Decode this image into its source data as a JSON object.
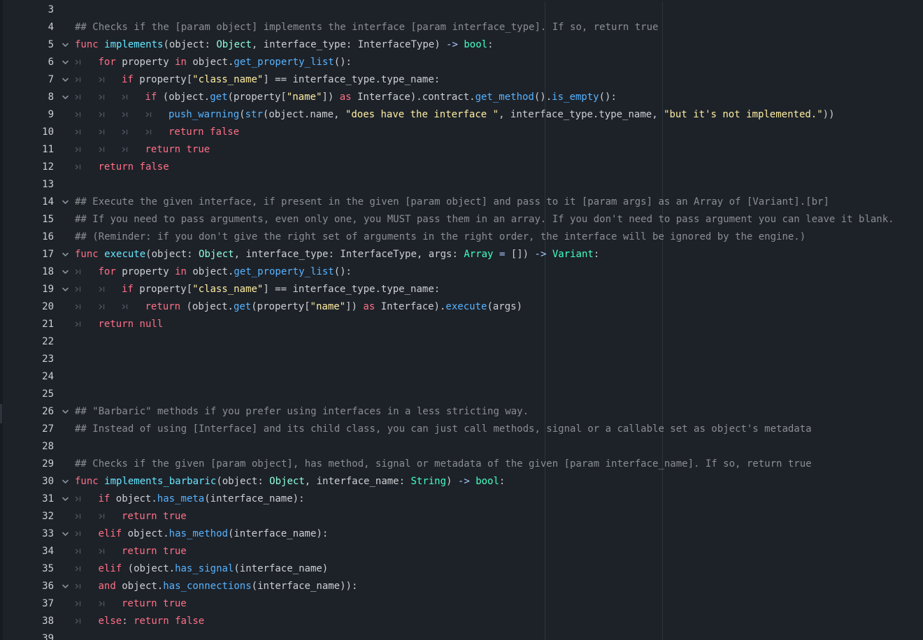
{
  "editor": {
    "language": "GDScript",
    "colors": {
      "background": "#1d2229",
      "keyword": "#ff7085",
      "function_call": "#57b3ff",
      "function_def": "#66e6ff",
      "type": "#8effda",
      "builtin_type": "#42ffc2",
      "string": "#ffeda1",
      "comment": "#cdcfd2a0",
      "text": "#cdcfd2"
    },
    "indent_glyph": "›|",
    "fold_icon": "chevron-down-icon",
    "lines": [
      {
        "n": "3",
        "fold": false,
        "indent": 0,
        "tokens": []
      },
      {
        "n": "4",
        "fold": false,
        "indent": 0,
        "tokens": [
          [
            "c",
            "## Checks if the [param object] implements the interface [param interface_type]. If so, return true"
          ]
        ]
      },
      {
        "n": "5",
        "fold": true,
        "indent": 0,
        "tokens": [
          [
            "k",
            "func"
          ],
          [
            "p",
            " "
          ],
          [
            "fd",
            "implements"
          ],
          [
            "p",
            "(object: "
          ],
          [
            "t",
            "Object"
          ],
          [
            "p",
            ", interface_type: "
          ],
          [
            "p",
            "InterfaceType"
          ],
          [
            "p",
            ") "
          ],
          [
            "o",
            "->"
          ],
          [
            "p",
            " "
          ],
          [
            "ty",
            "bool"
          ],
          [
            "p",
            ":"
          ]
        ]
      },
      {
        "n": "6",
        "fold": true,
        "indent": 1,
        "tokens": [
          [
            "k",
            "for"
          ],
          [
            "p",
            " property "
          ],
          [
            "k",
            "in"
          ],
          [
            "p",
            " object."
          ],
          [
            "f",
            "get_property_list"
          ],
          [
            "p",
            "():"
          ]
        ]
      },
      {
        "n": "7",
        "fold": true,
        "indent": 2,
        "tokens": [
          [
            "k",
            "if"
          ],
          [
            "p",
            " property["
          ],
          [
            "s",
            "\"class_name\""
          ],
          [
            "p",
            "] == interface_type.type_name:"
          ]
        ]
      },
      {
        "n": "8",
        "fold": true,
        "indent": 3,
        "tokens": [
          [
            "k",
            "if"
          ],
          [
            "p",
            " (object."
          ],
          [
            "f",
            "get"
          ],
          [
            "p",
            "(property["
          ],
          [
            "s",
            "\"name\""
          ],
          [
            "p",
            "]) "
          ],
          [
            "k",
            "as"
          ],
          [
            "p",
            " Interface).contract."
          ],
          [
            "f",
            "get_method"
          ],
          [
            "p",
            "()."
          ],
          [
            "f",
            "is_empty"
          ],
          [
            "p",
            "():"
          ]
        ]
      },
      {
        "n": "9",
        "fold": false,
        "indent": 4,
        "tokens": [
          [
            "f",
            "push_warning"
          ],
          [
            "p",
            "("
          ],
          [
            "f",
            "str"
          ],
          [
            "p",
            "(object.name, "
          ],
          [
            "s",
            "\"does have the interface \""
          ],
          [
            "p",
            ", interface_type.type_name, "
          ],
          [
            "s",
            "\"but it's not implemented.\""
          ],
          [
            "p",
            "))"
          ]
        ]
      },
      {
        "n": "10",
        "fold": false,
        "indent": 4,
        "tokens": [
          [
            "k",
            "return"
          ],
          [
            "p",
            " "
          ],
          [
            "k",
            "false"
          ]
        ]
      },
      {
        "n": "11",
        "fold": false,
        "indent": 3,
        "tokens": [
          [
            "k",
            "return"
          ],
          [
            "p",
            " "
          ],
          [
            "k",
            "true"
          ]
        ]
      },
      {
        "n": "12",
        "fold": false,
        "indent": 1,
        "tokens": [
          [
            "k",
            "return"
          ],
          [
            "p",
            " "
          ],
          [
            "k",
            "false"
          ]
        ]
      },
      {
        "n": "13",
        "fold": false,
        "indent": 0,
        "tokens": []
      },
      {
        "n": "14",
        "fold": true,
        "indent": 0,
        "tokens": [
          [
            "c",
            "## Execute the given interface, if present in the given [param object] and pass to it [param args] as an Array of [Variant].[br]"
          ]
        ]
      },
      {
        "n": "15",
        "fold": false,
        "indent": 0,
        "tokens": [
          [
            "c",
            "## If you need to pass arguments, even only one, you MUST pass them in an array. If you don't need to pass argument you can leave it blank."
          ]
        ]
      },
      {
        "n": "16",
        "fold": false,
        "indent": 0,
        "tokens": [
          [
            "c",
            "## (Reminder: if you don't give the right set of arguments in the right order, the interface will be ignored by the engine.)"
          ]
        ]
      },
      {
        "n": "17",
        "fold": true,
        "indent": 0,
        "tokens": [
          [
            "k",
            "func"
          ],
          [
            "p",
            " "
          ],
          [
            "fd",
            "execute"
          ],
          [
            "p",
            "(object: "
          ],
          [
            "t",
            "Object"
          ],
          [
            "p",
            ", interface_type: "
          ],
          [
            "p",
            "InterfaceType"
          ],
          [
            "p",
            ", args: "
          ],
          [
            "ty",
            "Array"
          ],
          [
            "p",
            " "
          ],
          [
            "o",
            "="
          ],
          [
            "p",
            " []) "
          ],
          [
            "o",
            "->"
          ],
          [
            "p",
            " "
          ],
          [
            "ty",
            "Variant"
          ],
          [
            "p",
            ":"
          ]
        ]
      },
      {
        "n": "18",
        "fold": true,
        "indent": 1,
        "tokens": [
          [
            "k",
            "for"
          ],
          [
            "p",
            " property "
          ],
          [
            "k",
            "in"
          ],
          [
            "p",
            " object."
          ],
          [
            "f",
            "get_property_list"
          ],
          [
            "p",
            "():"
          ]
        ]
      },
      {
        "n": "19",
        "fold": true,
        "indent": 2,
        "tokens": [
          [
            "k",
            "if"
          ],
          [
            "p",
            " property["
          ],
          [
            "s",
            "\"class_name\""
          ],
          [
            "p",
            "] == interface_type.type_name:"
          ]
        ]
      },
      {
        "n": "20",
        "fold": false,
        "indent": 3,
        "tokens": [
          [
            "k",
            "return"
          ],
          [
            "p",
            " (object."
          ],
          [
            "f",
            "get"
          ],
          [
            "p",
            "(property["
          ],
          [
            "s",
            "\"name\""
          ],
          [
            "p",
            "]) "
          ],
          [
            "k",
            "as"
          ],
          [
            "p",
            " Interface)."
          ],
          [
            "f",
            "execute"
          ],
          [
            "p",
            "(args)"
          ]
        ]
      },
      {
        "n": "21",
        "fold": false,
        "indent": 1,
        "tokens": [
          [
            "k",
            "return"
          ],
          [
            "p",
            " "
          ],
          [
            "k",
            "null"
          ]
        ]
      },
      {
        "n": "22",
        "fold": false,
        "indent": 0,
        "tokens": []
      },
      {
        "n": "23",
        "fold": false,
        "indent": 0,
        "tokens": []
      },
      {
        "n": "24",
        "fold": false,
        "indent": 0,
        "tokens": []
      },
      {
        "n": "25",
        "fold": false,
        "indent": 0,
        "tokens": []
      },
      {
        "n": "26",
        "fold": true,
        "indent": 0,
        "tokens": [
          [
            "c",
            "## \"Barbaric\" methods if you prefer using interfaces in a less stricting way."
          ]
        ]
      },
      {
        "n": "27",
        "fold": false,
        "indent": 0,
        "tokens": [
          [
            "c",
            "## Instead of using [Interface] and its child class, you can just call methods, signal or a callable set as object's metadata"
          ]
        ]
      },
      {
        "n": "28",
        "fold": false,
        "indent": 0,
        "tokens": []
      },
      {
        "n": "29",
        "fold": false,
        "indent": 0,
        "tokens": [
          [
            "c",
            "## Checks if the given [param object], has method, signal or metadata of the given [param interface_name]. If so, return true"
          ]
        ]
      },
      {
        "n": "30",
        "fold": true,
        "indent": 0,
        "tokens": [
          [
            "k",
            "func"
          ],
          [
            "p",
            " "
          ],
          [
            "fd",
            "implements_barbaric"
          ],
          [
            "p",
            "(object: "
          ],
          [
            "t",
            "Object"
          ],
          [
            "p",
            ", interface_name: "
          ],
          [
            "ty",
            "String"
          ],
          [
            "p",
            ") "
          ],
          [
            "o",
            "->"
          ],
          [
            "p",
            " "
          ],
          [
            "ty",
            "bool"
          ],
          [
            "p",
            ":"
          ]
        ]
      },
      {
        "n": "31",
        "fold": true,
        "indent": 1,
        "tokens": [
          [
            "k",
            "if"
          ],
          [
            "p",
            " object."
          ],
          [
            "f",
            "has_meta"
          ],
          [
            "p",
            "(interface_name):"
          ]
        ]
      },
      {
        "n": "32",
        "fold": false,
        "indent": 2,
        "tokens": [
          [
            "k",
            "return"
          ],
          [
            "p",
            " "
          ],
          [
            "k",
            "true"
          ]
        ]
      },
      {
        "n": "33",
        "fold": true,
        "indent": 1,
        "tokens": [
          [
            "k",
            "elif"
          ],
          [
            "p",
            " object."
          ],
          [
            "f",
            "has_method"
          ],
          [
            "p",
            "(interface_name):"
          ]
        ]
      },
      {
        "n": "34",
        "fold": false,
        "indent": 2,
        "tokens": [
          [
            "k",
            "return"
          ],
          [
            "p",
            " "
          ],
          [
            "k",
            "true"
          ]
        ]
      },
      {
        "n": "35",
        "fold": false,
        "indent": 1,
        "tokens": [
          [
            "k",
            "elif"
          ],
          [
            "p",
            " (object."
          ],
          [
            "f",
            "has_signal"
          ],
          [
            "p",
            "(interface_name)"
          ]
        ]
      },
      {
        "n": "36",
        "fold": true,
        "indent": 1,
        "tokens": [
          [
            "k",
            "and"
          ],
          [
            "p",
            " object."
          ],
          [
            "f",
            "has_connections"
          ],
          [
            "p",
            "(interface_name)):"
          ]
        ]
      },
      {
        "n": "37",
        "fold": false,
        "indent": 2,
        "tokens": [
          [
            "k",
            "return"
          ],
          [
            "p",
            " "
          ],
          [
            "k",
            "true"
          ]
        ]
      },
      {
        "n": "38",
        "fold": false,
        "indent": 1,
        "tokens": [
          [
            "k",
            "else"
          ],
          [
            "p",
            ": "
          ],
          [
            "k",
            "return"
          ],
          [
            "p",
            " "
          ],
          [
            "k",
            "false"
          ]
        ]
      },
      {
        "n": "39",
        "fold": false,
        "indent": 0,
        "tokens": []
      }
    ]
  }
}
